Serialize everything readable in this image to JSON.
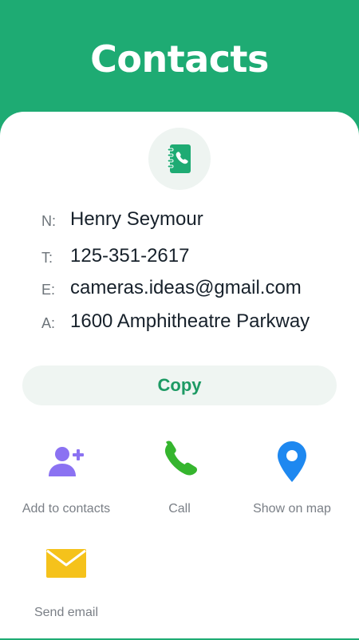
{
  "header": {
    "title": "Contacts"
  },
  "badge": {
    "icon": "address-book-icon",
    "icon_color": "#1eab73"
  },
  "fields": [
    {
      "key": "N:",
      "value": "Henry Seymour"
    },
    {
      "key": "T:",
      "value": "125-351-2617"
    },
    {
      "key": "E:",
      "value": "cameras.ideas@gmail.com"
    },
    {
      "key": "A:",
      "value": "1600 Amphitheatre Parkway"
    }
  ],
  "copy_button": {
    "label": "Copy"
  },
  "actions": [
    {
      "label": "Add to contacts",
      "icon": "add-person-icon",
      "color": "#8b72f2"
    },
    {
      "label": "Call",
      "icon": "phone-icon",
      "color": "#35b52e"
    },
    {
      "label": "Show on map",
      "icon": "map-pin-icon",
      "color": "#1e88f0"
    },
    {
      "label": "Send email",
      "icon": "envelope-icon",
      "color": "#f5c21b"
    }
  ],
  "colors": {
    "brand": "#1eab73",
    "copy_text": "#1d9a64"
  }
}
